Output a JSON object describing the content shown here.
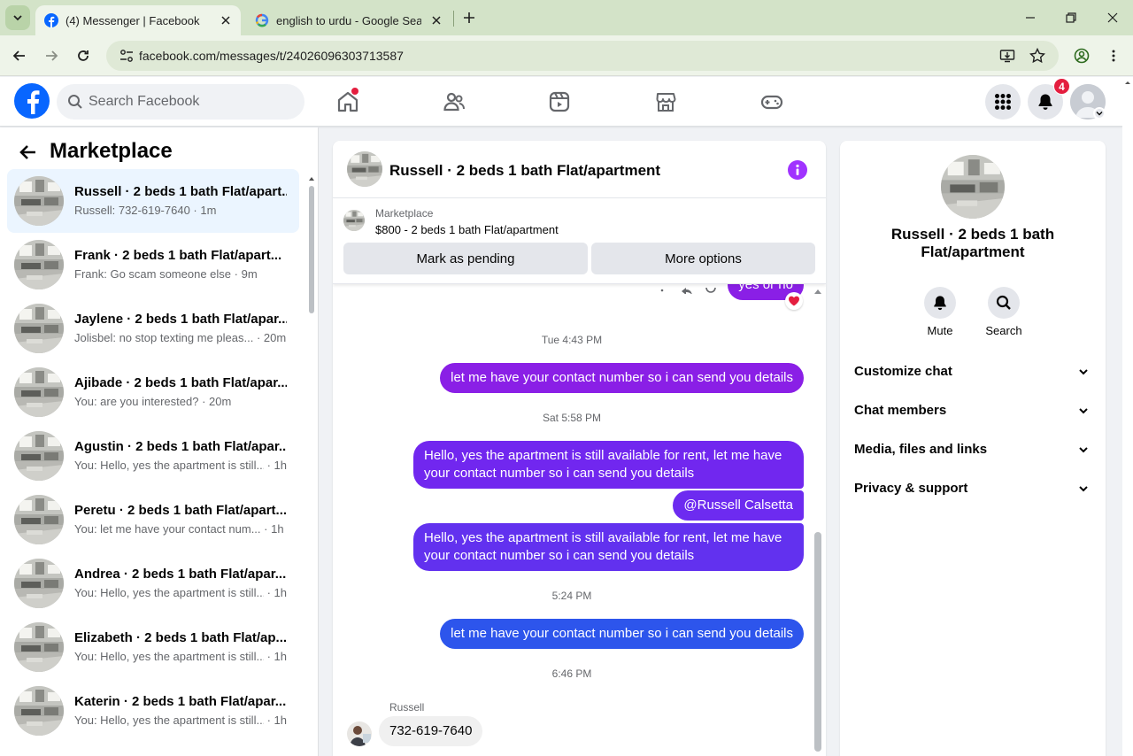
{
  "browser": {
    "tabs": [
      {
        "title": "(4) Messenger | Facebook",
        "favicon": "facebook-icon",
        "active": true
      },
      {
        "title": "english to urdu - Google Search",
        "favicon": "google-icon",
        "active": false
      }
    ],
    "url": "facebook.com/messages/t/24026096303713587"
  },
  "fb_header": {
    "search_placeholder": "Search Facebook",
    "notification_count": "4",
    "nav_icons": [
      "home-icon",
      "friends-icon",
      "video-icon",
      "marketplace-icon",
      "gaming-icon"
    ]
  },
  "left_panel": {
    "title": "Marketplace",
    "conversations": [
      {
        "name": "Russell · 2 beds 1 bath Flat/apart...",
        "preview": "Russell: 732-619-7640",
        "time": "1m",
        "active": true
      },
      {
        "name": "Frank · 2 beds 1 bath Flat/apart...",
        "preview": "Frank: Go scam someone else",
        "time": "9m",
        "active": false
      },
      {
        "name": "Jaylene · 2 beds 1 bath Flat/apar...",
        "preview": "Jolisbel: no stop texting me pleas...",
        "time": "20m",
        "active": false
      },
      {
        "name": "Ajibade · 2 beds 1 bath Flat/apar...",
        "preview": "You: are you interested?",
        "time": "20m",
        "active": false
      },
      {
        "name": "Agustin · 2 beds 1 bath Flat/apar...",
        "preview": "You: Hello, yes the apartment is still...",
        "time": "1h",
        "active": false
      },
      {
        "name": "Peretu · 2 beds 1 bath Flat/apart...",
        "preview": "You: let me have your contact num...",
        "time": "1h",
        "active": false
      },
      {
        "name": "Andrea · 2 beds 1 bath Flat/apar...",
        "preview": "You: Hello, yes the apartment is still...",
        "time": "1h",
        "active": false
      },
      {
        "name": "Elizabeth · 2 beds 1 bath Flat/ap...",
        "preview": "You: Hello, yes the apartment is still...",
        "time": "1h",
        "active": false
      },
      {
        "name": "Katerin · 2 beds 1 bath Flat/apar...",
        "preview": "You: Hello, yes the apartment is still...",
        "time": "1h",
        "active": false
      }
    ]
  },
  "chat": {
    "title": "Russell · 2 beds 1 bath Flat/apartment",
    "marketplace_label": "Marketplace",
    "listing": "$800 - 2 beds 1 bath Flat/apartment",
    "mark_pending_label": "Mark as pending",
    "more_options_label": "More options",
    "partial_message": "yes or no",
    "timestamps": [
      "Tue 4:43 PM",
      "Sat 5:58 PM",
      "5:24 PM",
      "6:46 PM"
    ],
    "messages": {
      "m1": "let me have your contact number so i can send you details",
      "m2": "Hello, yes the apartment is still available for rent, let me have your contact number so i can send you details",
      "m3": "@Russell Calsetta",
      "m4": "Hello, yes the apartment is still available for rent, let me have your contact number so i can send you details",
      "m5": "let me have your contact number so i can send you details"
    },
    "incoming_sender": "Russell",
    "incoming_message": "732-619-7640",
    "colors": {
      "purple": "#8a1fe6",
      "violet": "#6d2bf0",
      "blue": "#2d55ec",
      "reaction": "#e41e3f"
    }
  },
  "right_panel": {
    "name": "Russell · 2 beds 1 bath Flat/apartment",
    "actions": [
      {
        "label": "Mute",
        "icon": "bell-icon"
      },
      {
        "label": "Search",
        "icon": "search-icon"
      }
    ],
    "sections": [
      "Customize chat",
      "Chat members",
      "Media, files and links",
      "Privacy & support"
    ]
  }
}
